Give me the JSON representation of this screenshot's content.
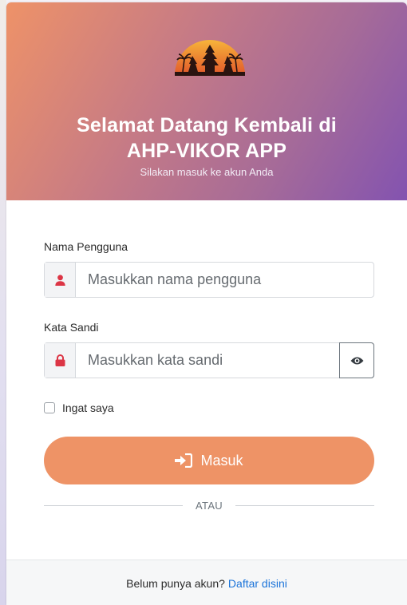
{
  "hero": {
    "title_line1": "Selamat Datang Kembali di",
    "title_line2": "AHP-VIKOR APP",
    "subtitle": "Silakan masuk ke akun Anda",
    "logo_icon": "bali-temple-sunset-logo"
  },
  "form": {
    "username": {
      "label": "Nama Pengguna",
      "placeholder": "Masukkan nama pengguna",
      "value": "",
      "icon": "user-icon"
    },
    "password": {
      "label": "Kata Sandi",
      "placeholder": "Masukkan kata sandi",
      "value": "",
      "icon": "lock-icon",
      "toggle_icon": "eye-icon"
    },
    "remember_label": "Ingat saya",
    "remember_checked": false,
    "submit_label": "Masuk",
    "submit_icon": "sign-in-icon",
    "divider_text": "ATAU"
  },
  "footer": {
    "text": "Belum punya akun?",
    "link": "Daftar disini"
  },
  "colors": {
    "accent": "#ee9366",
    "icon_red": "#dc3545",
    "link": "#1a73d9"
  }
}
